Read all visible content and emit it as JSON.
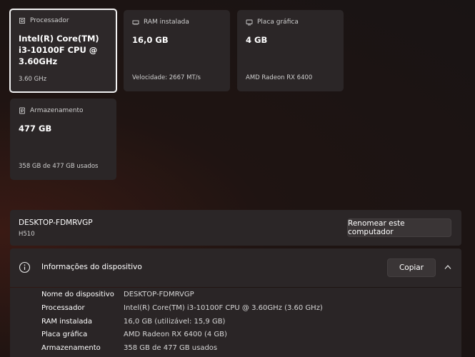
{
  "cards": [
    {
      "id": "processor",
      "label": "Processador",
      "title": "Intel(R) Core(TM) i3-10100F CPU @ 3.60GHz",
      "sub": "3.60 GHz",
      "icon": "processor-icon"
    },
    {
      "id": "ram",
      "label": "RAM instalada",
      "title": "16,0 GB",
      "sub": "Velocidade: 2667 MT/s",
      "icon": "ram-icon"
    },
    {
      "id": "gpu",
      "label": "Placa gráfica",
      "title": "4 GB",
      "sub": "AMD Radeon RX 6400",
      "icon": "gpu-icon"
    },
    {
      "id": "storage",
      "label": "Armazenamento",
      "title": "477 GB",
      "sub": "358 GB de 477 GB usados",
      "icon": "storage-icon"
    }
  ],
  "computer": {
    "name": "DESKTOP-FDMRVGP",
    "model": "H510",
    "rename_label": "Renomear este computador"
  },
  "device_info": {
    "title": "Informações do dispositivo",
    "copy_label": "Copiar",
    "rows": [
      {
        "label": "Nome do dispositivo",
        "value": "DESKTOP-FDMRVGP"
      },
      {
        "label": "Processador",
        "value": "Intel(R) Core(TM) i3-10100F CPU @ 3.60GHz (3.60 GHz)"
      },
      {
        "label": "RAM instalada",
        "value": "16,0 GB (utilizável: 15,9 GB)"
      },
      {
        "label": "Placa gráfica",
        "value": "AMD Radeon RX 6400 (4 GB)"
      },
      {
        "label": "Armazenamento",
        "value": "358 GB de 477 GB usados"
      }
    ]
  }
}
